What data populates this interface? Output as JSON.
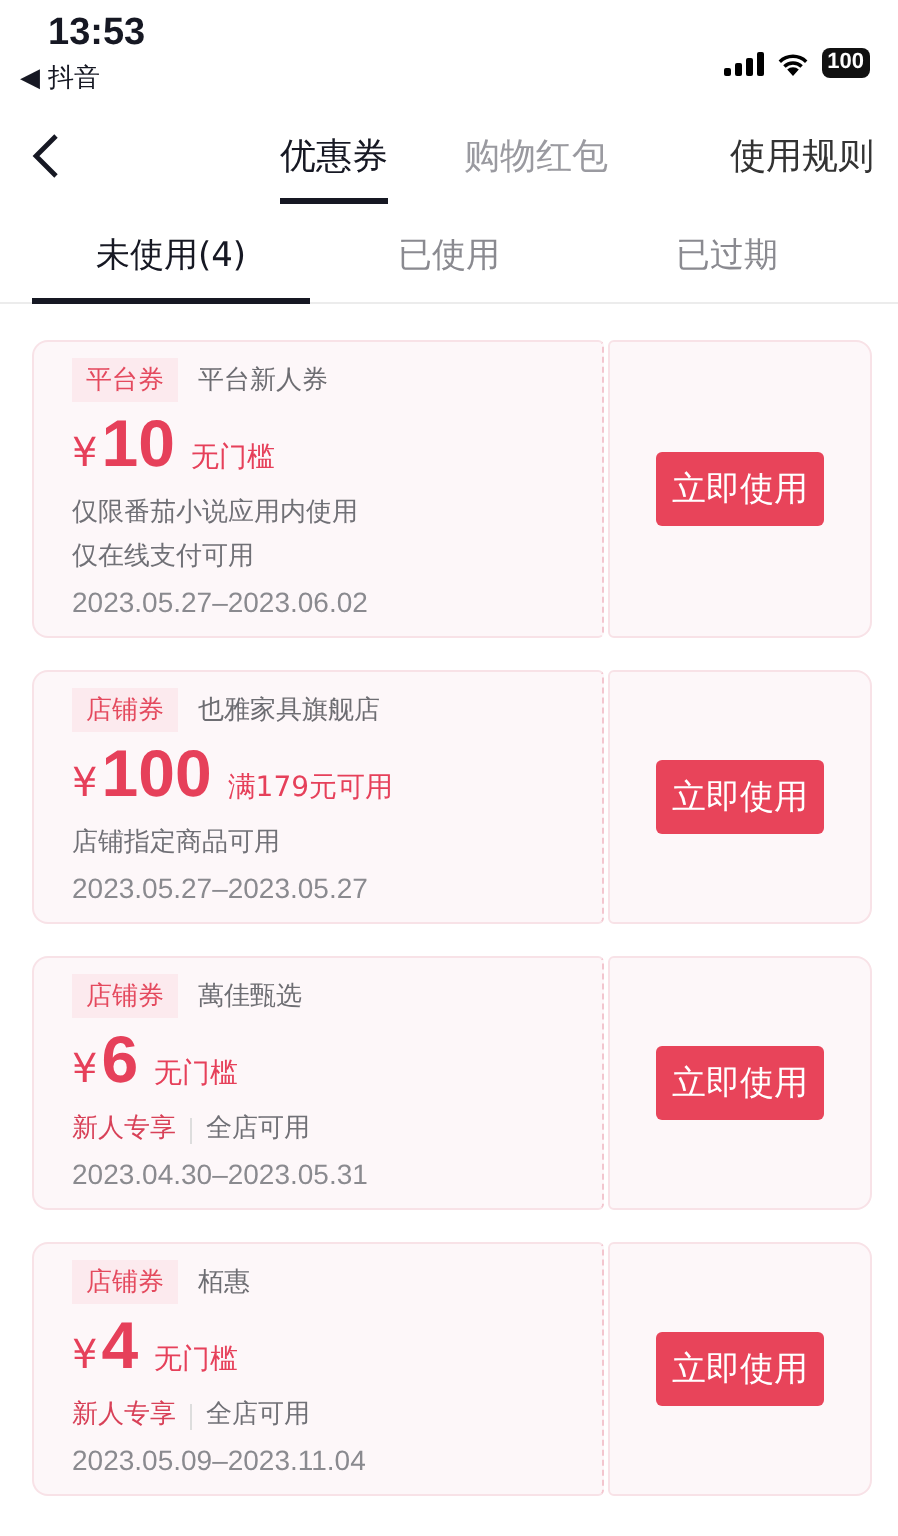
{
  "status_bar": {
    "time": "13:53",
    "back_app": "◀ 抖音",
    "battery": "100"
  },
  "nav": {
    "tabs": [
      {
        "label": "优惠券",
        "selected": true
      },
      {
        "label": "购物红包",
        "selected": false
      }
    ],
    "rules_link": "使用规则"
  },
  "sub_tabs": [
    {
      "label": "未使用(4)",
      "selected": true
    },
    {
      "label": "已使用",
      "selected": false
    },
    {
      "label": "已过期",
      "selected": false
    }
  ],
  "coupons": [
    {
      "tag": "平台券",
      "name": "平台新人券",
      "currency": "¥",
      "amount": "10",
      "condition": "无门槛",
      "lines": [
        {
          "kind": "text",
          "text": "仅限番茄小说应用内使用"
        },
        {
          "kind": "text",
          "text": "仅在线支付可用"
        }
      ],
      "validity": "2023.05.27–2023.06.02",
      "button": "立即使用"
    },
    {
      "tag": "店铺券",
      "name": "也雅家具旗舰店",
      "currency": "¥",
      "amount": "100",
      "condition": "满179元可用",
      "lines": [
        {
          "kind": "text",
          "text": "店铺指定商品可用"
        }
      ],
      "validity": "2023.05.27–2023.05.27",
      "button": "立即使用"
    },
    {
      "tag": "店铺券",
      "name": "萬佳甄选",
      "currency": "¥",
      "amount": "6",
      "condition": "无门槛",
      "lines": [
        {
          "kind": "pair",
          "highlight": "新人专享",
          "text": "全店可用"
        }
      ],
      "validity": "2023.04.30–2023.05.31",
      "button": "立即使用"
    },
    {
      "tag": "店铺券",
      "name": "栢惠",
      "currency": "¥",
      "amount": "4",
      "condition": "无门槛",
      "lines": [
        {
          "kind": "pair",
          "highlight": "新人专享",
          "text": "全店可用"
        }
      ],
      "validity": "2023.05.09–2023.11.04",
      "button": "立即使用"
    }
  ]
}
